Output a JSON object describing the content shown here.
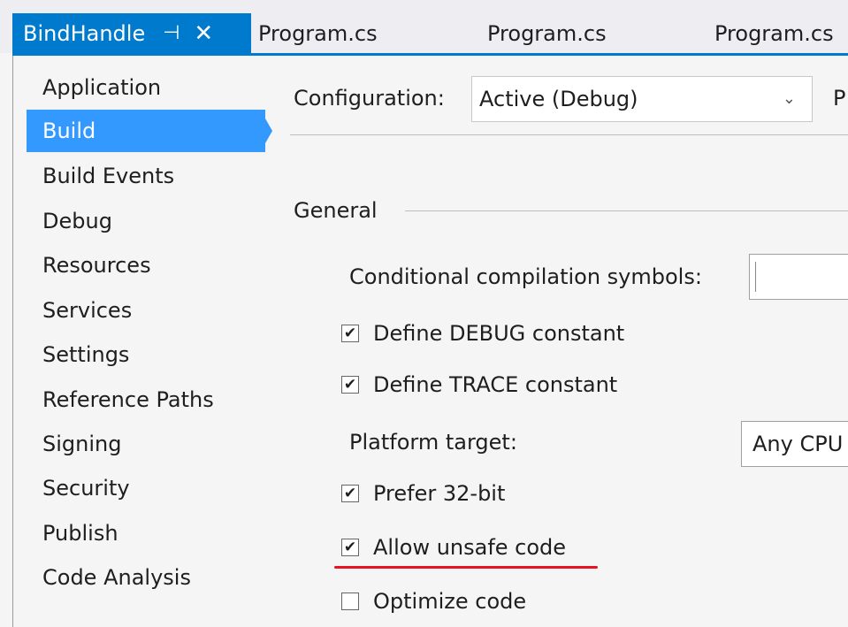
{
  "tabs": {
    "active": {
      "label": "BindHandle",
      "pin_icon": "pin-icon",
      "close_icon": "close-icon",
      "pin_glyph": "⊣",
      "close_glyph": "✕"
    },
    "others": [
      {
        "label": "Program.cs"
      },
      {
        "label": "Program.cs"
      },
      {
        "label": "Program.cs"
      }
    ]
  },
  "sidebar": {
    "items": [
      {
        "label": "Application"
      },
      {
        "label": "Build",
        "selected": true
      },
      {
        "label": "Build Events"
      },
      {
        "label": "Debug"
      },
      {
        "label": "Resources"
      },
      {
        "label": "Services"
      },
      {
        "label": "Settings"
      },
      {
        "label": "Reference Paths"
      },
      {
        "label": "Signing"
      },
      {
        "label": "Security"
      },
      {
        "label": "Publish"
      },
      {
        "label": "Code Analysis"
      }
    ]
  },
  "config": {
    "label": "Configuration:",
    "value": "Active (Debug)",
    "chevron": "⌄",
    "next_label": "P"
  },
  "general": {
    "section_label": "General",
    "cond_symbols_label": "Conditional compilation symbols:",
    "cond_symbols_value": "",
    "define_debug": {
      "label": "Define DEBUG constant",
      "checked": true
    },
    "define_trace": {
      "label": "Define TRACE constant",
      "checked": true
    },
    "platform_label": "Platform target:",
    "platform_value": "Any CPU",
    "prefer32": {
      "label": "Prefer 32-bit",
      "checked": true
    },
    "allow_unsafe": {
      "label": "Allow unsafe code",
      "checked": true
    },
    "optimize": {
      "label": "Optimize code",
      "checked": false
    },
    "check_glyph": "✔"
  },
  "colors": {
    "accent": "#007acc",
    "selection": "#3399ff",
    "highlight_underline": "#e81123"
  }
}
